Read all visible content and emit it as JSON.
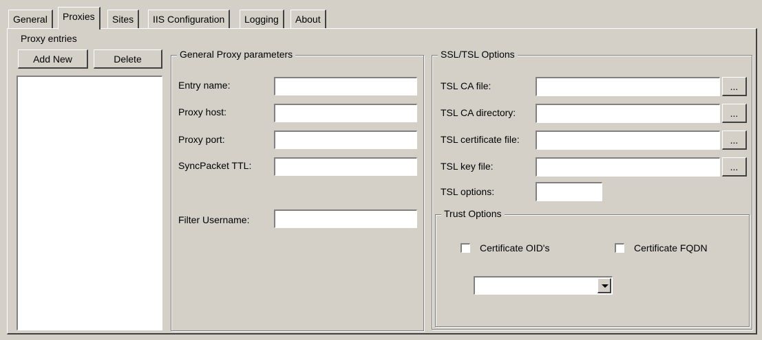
{
  "tabs": [
    {
      "label": "General"
    },
    {
      "label": "Proxies"
    },
    {
      "label": "Sites"
    },
    {
      "label": "IIS Configuration"
    },
    {
      "label": "Logging"
    },
    {
      "label": "About"
    }
  ],
  "proxy_entries": {
    "title": "Proxy entries",
    "add_label": "Add New",
    "delete_label": "Delete"
  },
  "general_params": {
    "title": "General Proxy parameters",
    "entry_name": {
      "label": "Entry name:",
      "value": ""
    },
    "proxy_host": {
      "label": "Proxy host:",
      "value": ""
    },
    "proxy_port": {
      "label": "Proxy port:",
      "value": ""
    },
    "sync_ttl": {
      "label": "SyncPacket TTL:",
      "value": ""
    },
    "filter_username": {
      "label": "Filter Username:",
      "value": ""
    }
  },
  "ssl": {
    "title": "SSL/TSL Options",
    "ca_file": {
      "label": "TSL CA file:",
      "value": ""
    },
    "ca_dir": {
      "label": "TSL CA directory:",
      "value": ""
    },
    "cert_file": {
      "label": "TSL certificate file:",
      "value": ""
    },
    "key_file": {
      "label": "TSL key file:",
      "value": ""
    },
    "options": {
      "label": "TSL options:",
      "value": ""
    },
    "browse_label": "...",
    "trust": {
      "title": "Trust Options",
      "oid_label": "Certificate OID's",
      "fqdn_label": "Certificate FQDN",
      "oid_checked": false,
      "fqdn_checked": false,
      "select_value": ""
    }
  }
}
